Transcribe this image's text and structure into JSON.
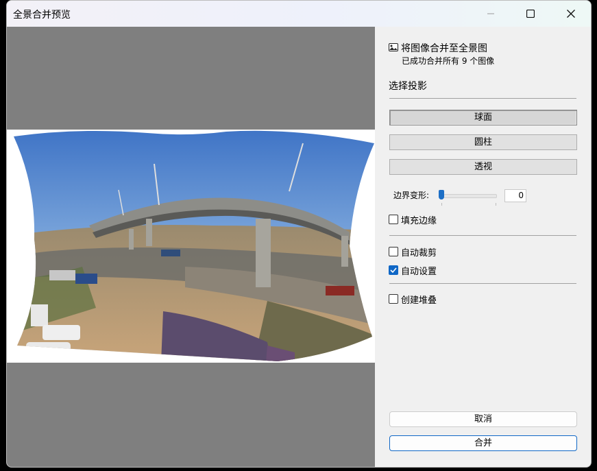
{
  "window": {
    "title": "全景合并预览"
  },
  "header": {
    "title": "将图像合并至全景图",
    "subtitle": "已成功合并所有 9 个图像"
  },
  "projection": {
    "label": "选择投影",
    "options": [
      "球面",
      "圆柱",
      "透视"
    ],
    "selected": "球面"
  },
  "boundary_warp": {
    "label": "边界变形:",
    "value": "0"
  },
  "checkboxes": {
    "fill_edges": {
      "label": "填充边缘",
      "checked": false
    },
    "auto_crop": {
      "label": "自动裁剪",
      "checked": false
    },
    "auto_settings": {
      "label": "自动设置",
      "checked": true
    },
    "create_stack": {
      "label": "创建堆叠",
      "checked": false
    }
  },
  "buttons": {
    "cancel": "取消",
    "merge": "合并"
  },
  "colors": {
    "accent": "#0f67c6",
    "preview_bg": "#7f7f7f",
    "panel_bg": "#f0f0f0"
  }
}
